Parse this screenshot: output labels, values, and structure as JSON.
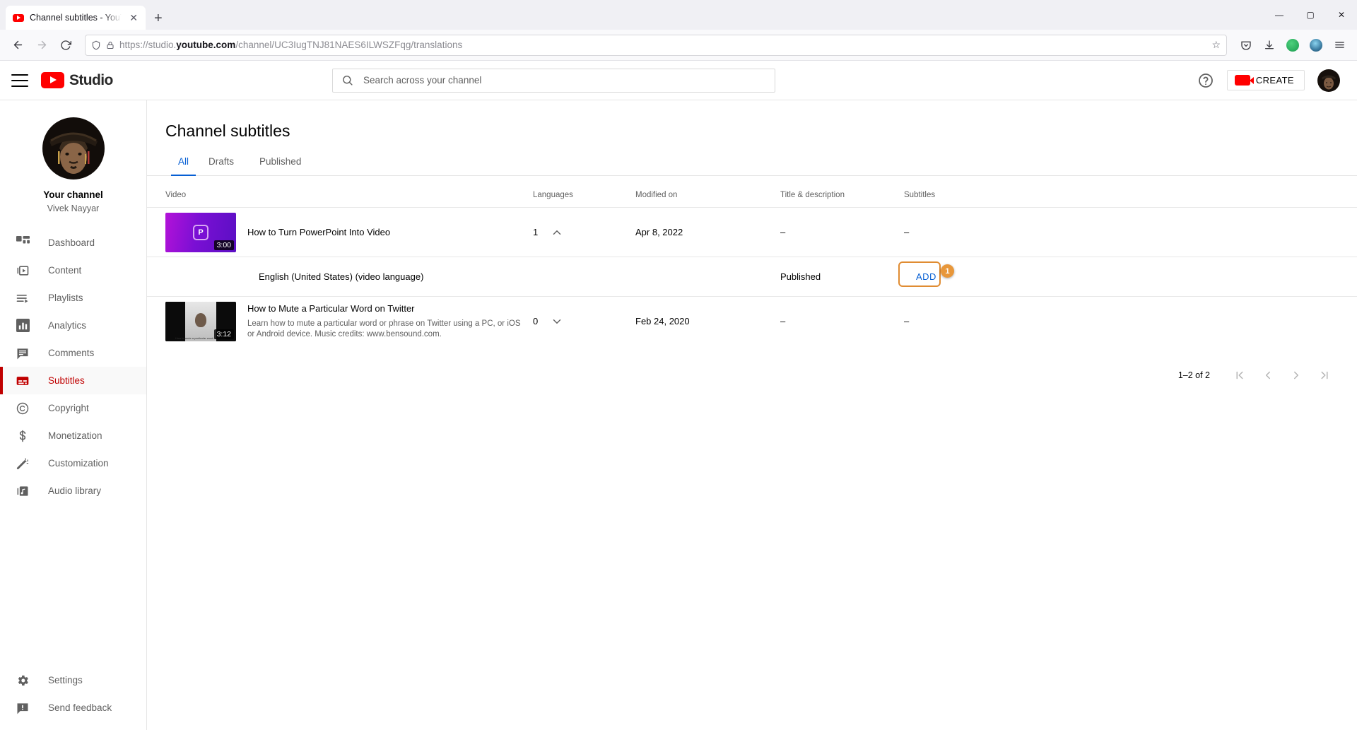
{
  "browser": {
    "tab": {
      "title": "Channel subtitles - YouTube Stu",
      "favicon": "youtube-icon",
      "close": "✕"
    },
    "new_tab": "+",
    "window_controls": {
      "minimize": "—",
      "maximize": "▢",
      "close": "✕"
    },
    "nav": {
      "back": "←",
      "forward": "→",
      "reload": "⟳"
    },
    "url": {
      "prefix": "https://studio.",
      "domain": "youtube.com",
      "path": "/channel/UC3IugTNJ81NAES6ILWSZFqg/translations",
      "shield": "shield-icon",
      "lock": "lock-icon",
      "bookmark": "☆"
    },
    "toolbar_icons": [
      "pocket-icon",
      "downloads-icon",
      "grammarly-extension",
      "profile-avatar",
      "app-menu"
    ]
  },
  "header": {
    "menu": "hamburger-menu",
    "logo_text": "Studio",
    "search": {
      "placeholder": "Search across your channel",
      "value": ""
    },
    "help": "?",
    "create_label": "CREATE",
    "avatar": "account-avatar"
  },
  "sidebar": {
    "channel": {
      "label": "Your channel",
      "name": "Vivek Nayyar"
    },
    "items": [
      {
        "label": "Dashboard",
        "icon": "dashboard-icon",
        "active": false
      },
      {
        "label": "Content",
        "icon": "content-icon",
        "active": false
      },
      {
        "label": "Playlists",
        "icon": "playlists-icon",
        "active": false
      },
      {
        "label": "Analytics",
        "icon": "analytics-icon",
        "active": false
      },
      {
        "label": "Comments",
        "icon": "comments-icon",
        "active": false
      },
      {
        "label": "Subtitles",
        "icon": "subtitles-icon",
        "active": true
      },
      {
        "label": "Copyright",
        "icon": "copyright-icon",
        "active": false
      },
      {
        "label": "Monetization",
        "icon": "monetization-icon",
        "active": false
      },
      {
        "label": "Customization",
        "icon": "customization-icon",
        "active": false
      },
      {
        "label": "Audio library",
        "icon": "audio-library-icon",
        "active": false
      }
    ],
    "bottom_items": [
      {
        "label": "Settings",
        "icon": "gear-icon"
      },
      {
        "label": "Send feedback",
        "icon": "feedback-icon"
      }
    ]
  },
  "main": {
    "page_title": "Channel subtitles",
    "tabs": [
      {
        "label": "All",
        "active": true
      },
      {
        "label": "Drafts",
        "active": false
      },
      {
        "label": "Published",
        "active": false
      }
    ],
    "table_headers": {
      "video": "Video",
      "languages": "Languages",
      "modified": "Modified on",
      "title_desc": "Title & description",
      "subtitles": "Subtitles"
    },
    "rows": [
      {
        "title": "How to Turn PowerPoint Into Video",
        "description": "",
        "duration": "3:00",
        "languages": "1",
        "chevron": "chevron-up-icon",
        "modified": "Apr 8, 2022",
        "title_desc": "–",
        "subtitles": "–"
      },
      {
        "title": "How to Mute a Particular Word on Twitter",
        "description": "Learn how to mute a particular word or phrase on Twitter using a PC, or iOS or Android device. Music credits: www.bensound.com.",
        "duration": "3:12",
        "languages": "0",
        "chevron": "chevron-down-icon",
        "modified": "Feb 24, 2020",
        "title_desc": "–",
        "subtitles": "–"
      }
    ],
    "language_row": {
      "language": "English (United States) (video language)",
      "status": "Published",
      "add_label": "ADD",
      "badge": "1",
      "highlight_color": "#e08c32"
    },
    "pagination": {
      "range": "1–2 of 2",
      "first": "|‹",
      "prev": "‹",
      "next": "›",
      "last": "›|"
    }
  }
}
